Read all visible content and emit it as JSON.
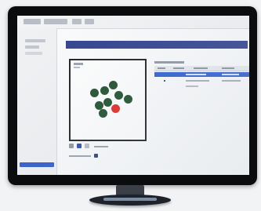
{
  "scene": {
    "colors": {
      "monitor_bezel": "#0b0c0e",
      "screen_bg": "#fbfcfd",
      "header_strip": "#30418e",
      "selected_row": "#2e5fd0",
      "sidebar_footer": "#2f59c9",
      "dot_green": "#1f4e2a",
      "dot_red": "#de2b25",
      "stand": "#1e232b"
    }
  }
}
